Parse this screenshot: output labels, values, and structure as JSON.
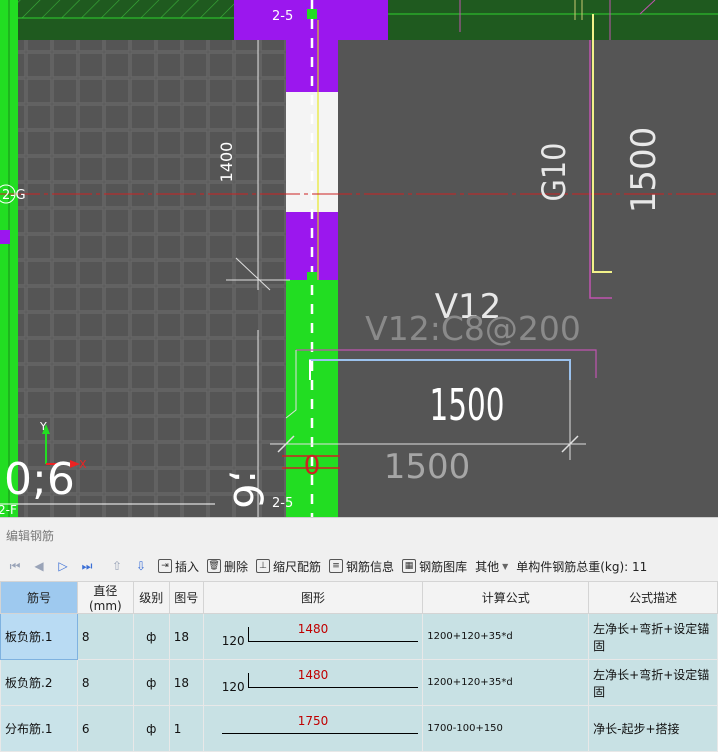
{
  "cad": {
    "labels": {
      "dim_1400": "1400",
      "g10": "G10",
      "dim_1500_vertical": "1500",
      "v12": "V12",
      "v12_spec": "V12:C8@200",
      "dim_1500_a": "1500",
      "dim_1500_b": "1500",
      "grid_2_5_top": "2-5",
      "grid_2_5_bottom": "2-5",
      "axis_g": "2-G",
      "axis_f": "2-F",
      "axis_x": "X",
      "axis_y": "Y",
      "coord_big": "0;6",
      "coord_side": ";6",
      "zero_label": "0"
    },
    "colors": {
      "canvas": "#555555",
      "green_band": "#1f5a1f",
      "green_bright": "#22dd22",
      "purple": "#9b17ee",
      "yellow": "#f2f28a",
      "magenta": "#c054b0",
      "red_axis": "#cc2222",
      "light_blue": "#9bc2ee"
    }
  },
  "panel": {
    "title": "编辑钢筋",
    "toolbar": {
      "insert": "插入",
      "delete": "删除",
      "scale_rebar": "缩尺配筋",
      "rebar_info": "钢筋信息",
      "rebar_library": "钢筋图库",
      "other": "其他",
      "total_weight": "单构件钢筋总重(kg): 11"
    },
    "columns": [
      "筋号",
      "直径(mm)",
      "级别",
      "图号",
      "图形",
      "计算公式",
      "公式描述"
    ],
    "rows": [
      {
        "row_num": "1",
        "name": "板负筋.1",
        "diameter": "8",
        "grade": "ф",
        "fig": "18",
        "shape_left": "120",
        "shape_len": "1480",
        "formula": "1200+120+35*d",
        "desc": "左净长+弯折+设定锚固"
      },
      {
        "row_num": "2",
        "name": "板负筋.2",
        "diameter": "8",
        "grade": "ф",
        "fig": "18",
        "shape_left": "120",
        "shape_len": "1480",
        "formula": "1200+120+35*d",
        "desc": "左净长+弯折+设定锚固"
      },
      {
        "row_num": "3",
        "name": "分布筋.1",
        "diameter": "6",
        "grade": "ф",
        "fig": "1",
        "shape_left": "",
        "shape_len": "1750",
        "formula": "1700-100+150",
        "desc": "净长-起步+搭接"
      }
    ]
  }
}
